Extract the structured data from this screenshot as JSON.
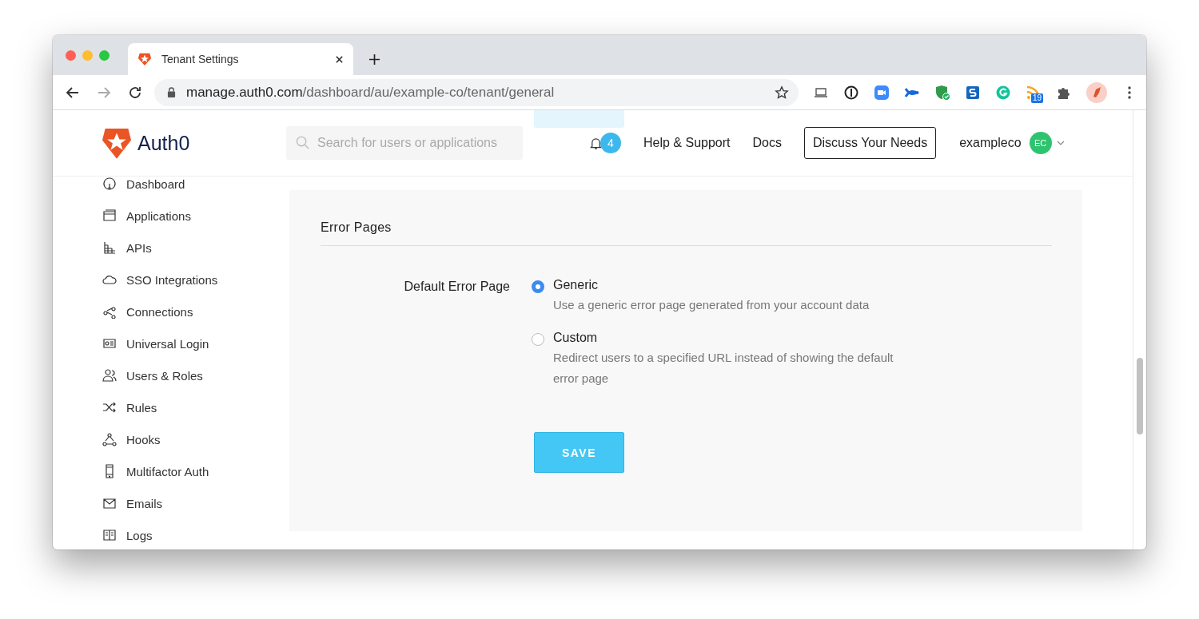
{
  "browser": {
    "tab_title": "Tenant Settings",
    "url_host": "manage.auth0.com",
    "url_path": "/dashboard/au/example-co/tenant/general",
    "extension_badge": "19"
  },
  "header": {
    "logo_text": "Auth0",
    "search": {
      "placeholder": "Search for users or applications"
    },
    "notification_count": "4",
    "links": [
      "Help & Support",
      "Docs"
    ],
    "cta": "Discuss Your Needs",
    "account": "exampleco",
    "avatar_initials": "EC"
  },
  "sidebar": {
    "items": [
      {
        "label": "Dashboard"
      },
      {
        "label": "Applications"
      },
      {
        "label": "APIs"
      },
      {
        "label": "SSO Integrations"
      },
      {
        "label": "Connections"
      },
      {
        "label": "Universal Login"
      },
      {
        "label": "Users & Roles"
      },
      {
        "label": "Rules"
      },
      {
        "label": "Hooks"
      },
      {
        "label": "Multifactor Auth"
      },
      {
        "label": "Emails"
      },
      {
        "label": "Logs"
      }
    ]
  },
  "section": {
    "title": "Error Pages",
    "field_label": "Default Error Page",
    "options": [
      {
        "label": "Generic",
        "description": "Use a generic error page generated from your account data",
        "selected": true
      },
      {
        "label": "Custom",
        "description": "Redirect users to a specified URL instead of showing the default error page",
        "selected": false
      }
    ],
    "save_button": "SAVE"
  }
}
